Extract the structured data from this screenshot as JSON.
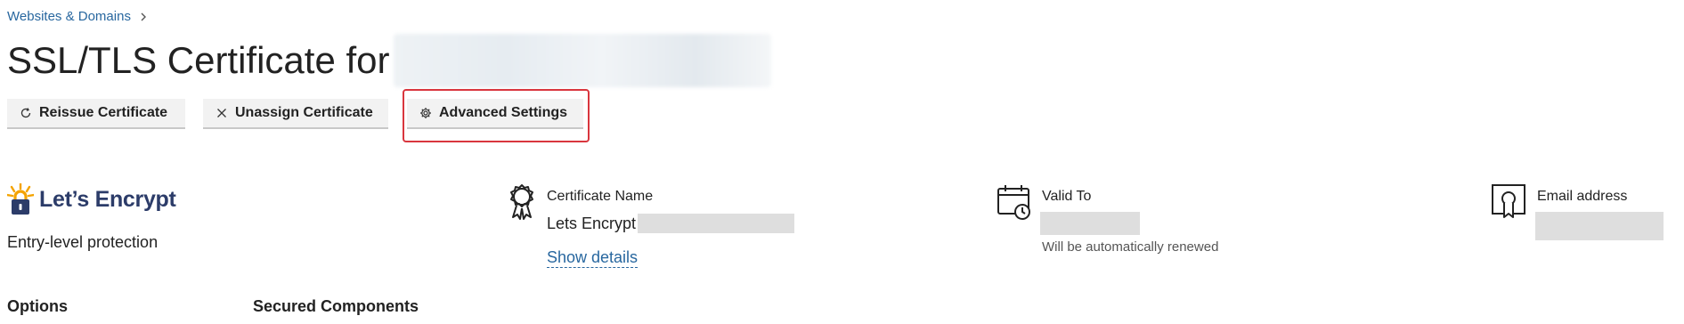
{
  "breadcrumb": {
    "items": [
      "Websites & Domains"
    ]
  },
  "page": {
    "title": "SSL/TLS Certificate for"
  },
  "toolbar": {
    "reissue_label": "Reissue Certificate",
    "unassign_label": "Unassign Certificate",
    "advanced_label": "Advanced Settings"
  },
  "provider": {
    "name": "Let’s Encrypt",
    "description": "Entry-level protection"
  },
  "certificate": {
    "name_label": "Certificate Name",
    "name_value": "Lets Encrypt",
    "details_link": "Show details"
  },
  "validity": {
    "label": "Valid To",
    "note": "Will be automatically renewed"
  },
  "email": {
    "label": "Email address"
  },
  "sections": {
    "options": "Options",
    "secured_components": "Secured Components"
  },
  "colors": {
    "accent": "#28679f",
    "highlight": "#d9363e",
    "brand": "#2c3c69",
    "brand_lock": "#f4a300"
  }
}
